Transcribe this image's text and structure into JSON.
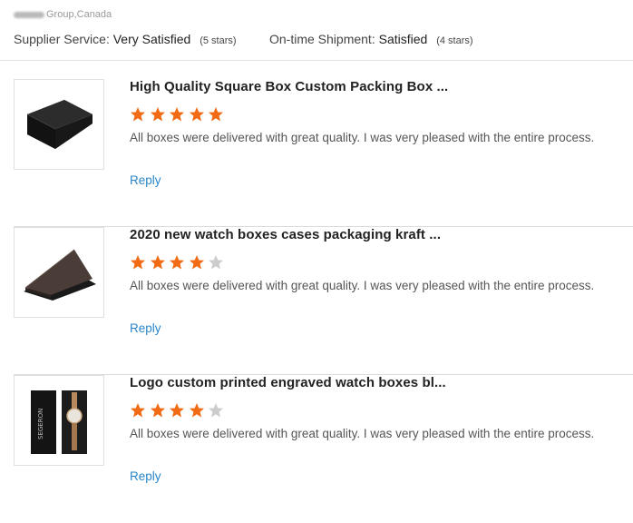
{
  "header": {
    "company_suffix": "Group,Canada",
    "ratings": [
      {
        "label": "Supplier Service:",
        "value": "Very Satisfied",
        "note": "(5 stars)"
      },
      {
        "label": "On-time Shipment:",
        "value": "Satisfied",
        "note": "(4 stars)"
      }
    ]
  },
  "colors": {
    "star_filled": "#f26b14",
    "star_empty": "#cccccc",
    "link": "#2a86c8"
  },
  "reviews": [
    {
      "title": "High Quality Square Box Custom Packing Box ...",
      "rating": 5,
      "max_rating": 5,
      "comment": "All boxes were delivered with great quality. I was very pleased with the entire process.",
      "reply_label": "Reply"
    },
    {
      "title": "2020 new watch boxes cases packaging kraft ...",
      "rating": 4,
      "max_rating": 5,
      "comment": "All boxes were delivered with great quality. I was very pleased with the entire process.",
      "reply_label": "Reply"
    },
    {
      "title": "Logo custom printed engraved watch boxes bl...",
      "rating": 4,
      "max_rating": 5,
      "comment": "All boxes were delivered with great quality. I was very pleased with the entire process.",
      "reply_label": "Reply",
      "product_text": "SEGERON"
    }
  ]
}
